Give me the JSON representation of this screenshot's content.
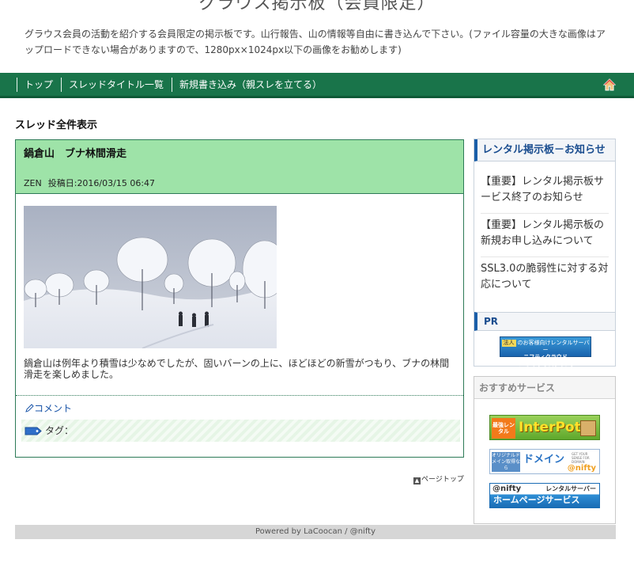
{
  "site": {
    "title": "グラウス掲示板（会員限定）",
    "description": "グラウス会員の活動を紹介する会員限定の掲示板です。山行報告、山の情報等自由に書き込んで下さい。(ファイル容量の大きな画像はアップロードできない場合がありますので、1280px×1024px以下の画像をお勧めします)"
  },
  "nav": {
    "items": [
      "トップ",
      "スレッドタイトル一覧",
      "新規書き込み（親スレを立てる）"
    ],
    "home_icon": "home-icon"
  },
  "main": {
    "heading": "スレッド全件表示",
    "thread": {
      "title": "鍋倉山　ブナ林間滑走",
      "author": "ZEN",
      "posted_label": "投稿日:",
      "posted_date": "2016/03/15 06:47",
      "body": "鍋倉山は例年より積雪は少なめでしたが、固いバーンの上に、ほどほどの新雪がつもり、ブナの林間滑走を楽しめました。",
      "comment_label": "コメント",
      "tag_label": "タグ："
    },
    "page_top": "ページトップ"
  },
  "sidebar": {
    "notice": {
      "title": "レンタル掲示板－お知らせ",
      "items": [
        "【重要】レンタル掲示板サービス終了のお知らせ",
        "【重要】レンタル掲示板の新規お申し込みについて",
        "SSL3.0の脆弱性に対する対応について"
      ],
      "pr_label": "PR",
      "pr_banner_line1_tag": "法人",
      "pr_banner_line1": "のお客様向けレンタルサーバー",
      "pr_banner_line2": "ニフティクラウド",
      "pr_banner_line3": "ベーシックホスティング"
    },
    "services": {
      "title": "おすすめサービス",
      "interpot": {
        "badge": "最強レンタル",
        "name": "InterPot"
      },
      "domain": {
        "left": "オリジナルドメイン取得なら",
        "name": "ドメイン",
        "sub": "GET YOUR SENSE FOR DOMAIN",
        "brand": "@nifty"
      },
      "homepage": {
        "brand": "@nifty",
        "tag": "レンタルサーバー",
        "name": "ホームページサービス"
      }
    }
  },
  "footer": {
    "text": "Powered by LaCoocan / @nifty"
  },
  "colors": {
    "nav_green": "#19744a",
    "thread_header": "#9ee3a8",
    "link_blue": "#1a55a8",
    "sidebar_title": "#1a4d8f"
  }
}
